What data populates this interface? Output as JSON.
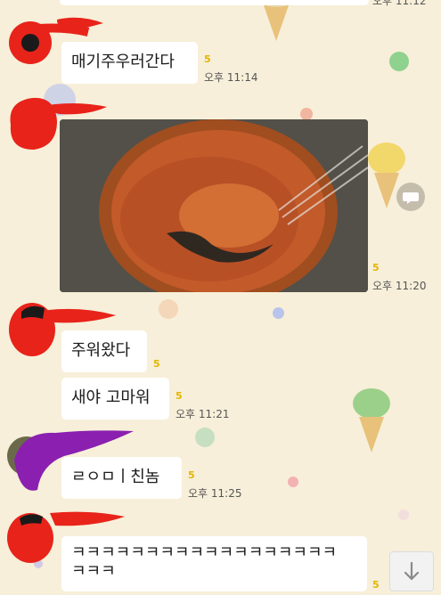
{
  "messages": [
    {
      "text": "매기주우러간다",
      "unread": "5",
      "time": "오후 11:14"
    },
    {
      "type": "image",
      "unread": "5",
      "time": "오후 11:20"
    },
    {
      "text": "주워왔다",
      "unread": "5"
    },
    {
      "text": "새야 고마워",
      "unread": "5",
      "time": "오후 11:21"
    },
    {
      "text": "ㄹㅇㅁㅣ친놈",
      "unread": "5",
      "time": "오후 11:25"
    },
    {
      "line1": "ㅋㅋㅋㅋㅋㅋㅋㅋㅋㅋㅋㅋㅋㅋㅋㅋㅋㅋ",
      "line2": "ㅋㅋㅋ",
      "unread": "5"
    }
  ],
  "top_partial_time": "오후 11:12",
  "icons": {
    "share": "share-chat-icon",
    "scroll_down": "arrow-down-icon"
  },
  "colors": {
    "background": "#f7efd9",
    "bubble": "#ffffff",
    "unread": "#e3b600",
    "redaction_red": "#e8231a",
    "redaction_purple": "#8a1fb0"
  }
}
